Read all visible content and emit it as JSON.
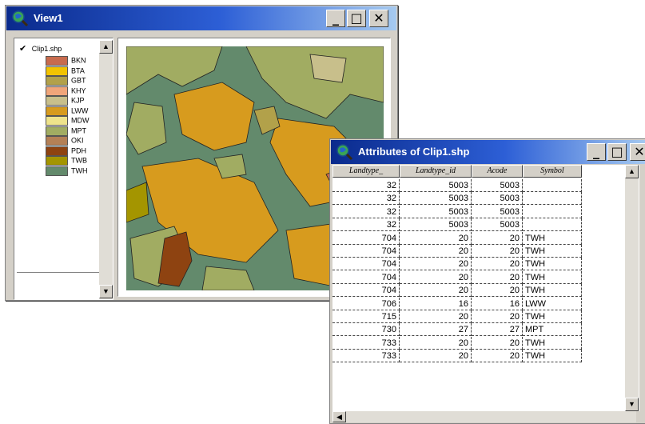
{
  "view_window": {
    "title": "View1",
    "buttons": {
      "minimize": "_",
      "maximize": "□",
      "close": "✕"
    },
    "layer": {
      "name": "Clip1.shp",
      "checked": true
    },
    "legend": [
      {
        "label": "BKN",
        "color": "#c86b4e"
      },
      {
        "label": "BTA",
        "color": "#f2c300"
      },
      {
        "label": "GBT",
        "color": "#b2a14a"
      },
      {
        "label": "KHY",
        "color": "#f0a57a"
      },
      {
        "label": "KJP",
        "color": "#c8bf8b"
      },
      {
        "label": "LWW",
        "color": "#d79b1e"
      },
      {
        "label": "MDW",
        "color": "#eee38b"
      },
      {
        "label": "MPT",
        "color": "#a1ac62"
      },
      {
        "label": "OKI",
        "color": "#b48056"
      },
      {
        "label": "PDH",
        "color": "#8e4311"
      },
      {
        "label": "TWB",
        "color": "#a49500"
      },
      {
        "label": "TWH",
        "color": "#638a6c"
      }
    ]
  },
  "attributes_window": {
    "title": "Attributes of Clip1.shp",
    "buttons": {
      "minimize": "_",
      "maximize": "□",
      "close": "✕"
    },
    "columns": [
      "Landtype_",
      "Landtype_id",
      "Acode",
      "Symbol"
    ],
    "rows": [
      [
        "32",
        "5003",
        "5003",
        ""
      ],
      [
        "32",
        "5003",
        "5003",
        ""
      ],
      [
        "32",
        "5003",
        "5003",
        ""
      ],
      [
        "32",
        "5003",
        "5003",
        ""
      ],
      [
        "704",
        "20",
        "20",
        "TWH"
      ],
      [
        "704",
        "20",
        "20",
        "TWH"
      ],
      [
        "704",
        "20",
        "20",
        "TWH"
      ],
      [
        "704",
        "20",
        "20",
        "TWH"
      ],
      [
        "704",
        "20",
        "20",
        "TWH"
      ],
      [
        "706",
        "16",
        "16",
        "LWW"
      ],
      [
        "715",
        "20",
        "20",
        "TWH"
      ],
      [
        "730",
        "27",
        "27",
        "MPT"
      ],
      [
        "733",
        "20",
        "20",
        "TWH"
      ],
      [
        "733",
        "20",
        "20",
        "TWH"
      ]
    ]
  },
  "icons": {
    "app": "globe-magnifier-icon",
    "layer_check": "checkmark-icon"
  },
  "colors": {
    "titlebar_start": "#0a2a8c",
    "titlebar_end": "#a6caf0",
    "chrome": "#d4d0c8"
  }
}
